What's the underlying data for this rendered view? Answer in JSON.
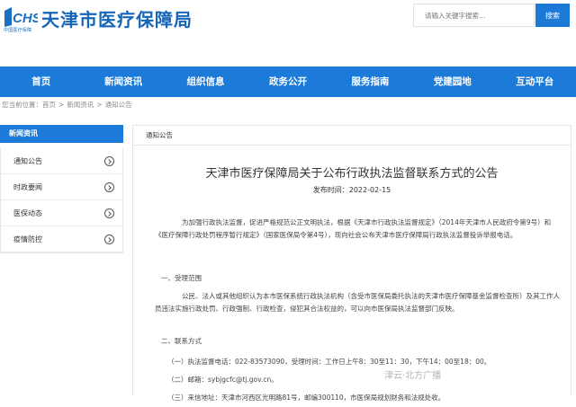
{
  "header": {
    "logo_mark": "CHS",
    "logo_cn": "中国医疗保障",
    "site_title": "天津市医疗保障局",
    "search_placeholder": "请输入关键字搜索...",
    "search_button": "搜索"
  },
  "nav": [
    "首页",
    "新闻资讯",
    "组织信息",
    "政务公开",
    "服务指南",
    "党建园地",
    "互动平台"
  ],
  "breadcrumb": {
    "prefix": "您当前位置：",
    "items": [
      "首页",
      "新闻资讯",
      "通知公告"
    ],
    "sep": ">"
  },
  "sidebar": {
    "title": "新闻资讯",
    "items": [
      "通知公告",
      "时政要闻",
      "医保动态",
      "疫情防控"
    ]
  },
  "content": {
    "section_label": "通知公告",
    "title": "天津市医疗保障局关于公布行政执法监督联系方式的公告",
    "date_label": "发布时间：",
    "date": "2022-02-15",
    "para1": "为加强行政执法监督，促进严格规范公正文明执法，根据《天津市行政执法监督规定》（2014年天津市人民政府令第9号）和《医疗保障行政处罚程序暂行规定》（国家医保局令第4号），现向社会公布天津市医疗保障局行政执法监督投诉举报电话。",
    "sec1": "一、受理范围",
    "para2": "公民、法人或其他组织认为本市医保系统行政执法机构（含受市医保局委托执法的天津市医疗保障基金监督检查所）及其工作人员违法实施行政处罚、行政强制、行政检查，侵犯其合法权益的，可以向市医保局执法监督部门反映。",
    "sec2": "二、联系方式",
    "item1": "（一）执法监督电话：022-83573090，受理时间：工作日上午8：30至11：30，下午14：00至18：00。",
    "item2": "（二）邮箱：sybjgcfc@tj.gov.cn。",
    "item3": "（三）来信地址：天津市河西区光明路81号，邮编300110，市医保局规划财务和法规处收。",
    "watermark": "津云·北方广播"
  },
  "colors": {
    "primary": "#1c7bd9",
    "title_blue": "#1565b8"
  }
}
